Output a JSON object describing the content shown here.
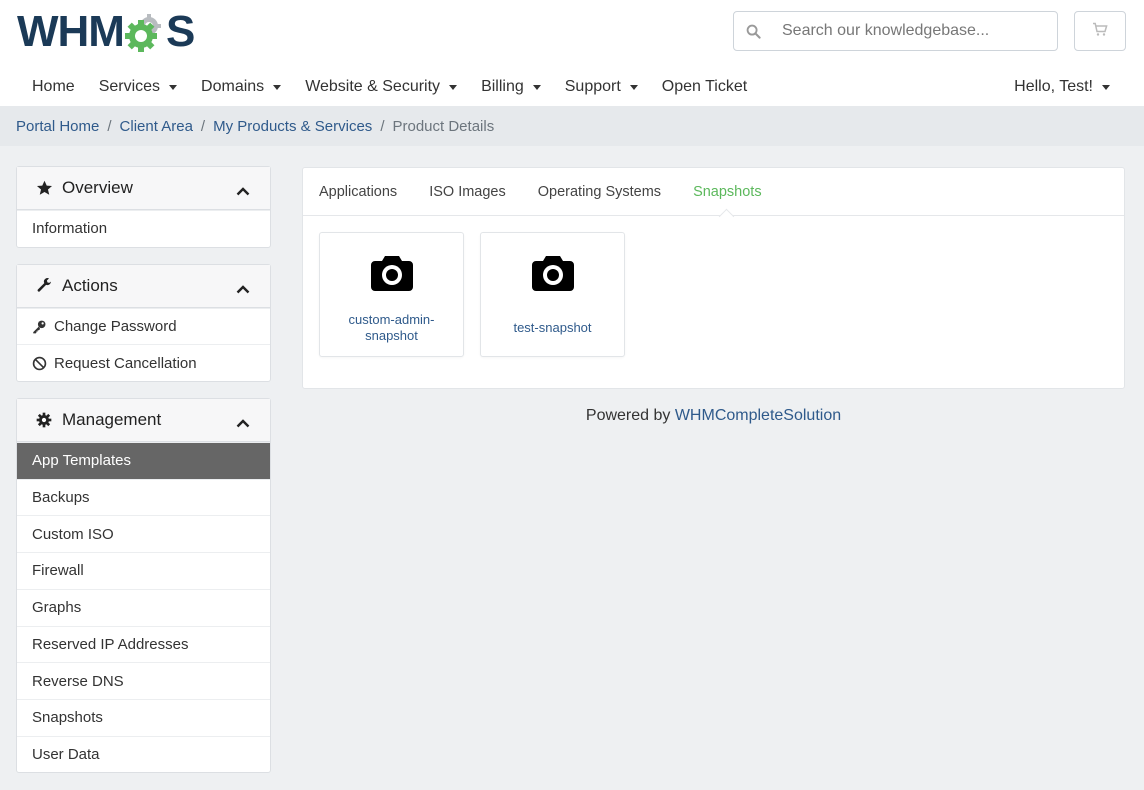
{
  "brand": {
    "logo_left": "WHM",
    "logo_right": "S",
    "accent": "#5cb85c",
    "navy": "#1b3a57"
  },
  "search": {
    "placeholder": "Search our knowledgebase..."
  },
  "nav": {
    "items": [
      {
        "label": "Home",
        "dropdown": false
      },
      {
        "label": "Services",
        "dropdown": true
      },
      {
        "label": "Domains",
        "dropdown": true
      },
      {
        "label": "Website & Security",
        "dropdown": true
      },
      {
        "label": "Billing",
        "dropdown": true
      },
      {
        "label": "Support",
        "dropdown": true
      },
      {
        "label": "Open Ticket",
        "dropdown": false
      }
    ],
    "user_greeting": "Hello, Test!"
  },
  "breadcrumb": {
    "items": [
      "Portal Home",
      "Client Area",
      "My Products & Services"
    ],
    "active": "Product Details"
  },
  "sidebar": {
    "overview": {
      "title": "Overview",
      "items": [
        "Information"
      ]
    },
    "actions": {
      "title": "Actions",
      "items": [
        "Change Password",
        "Request Cancellation"
      ]
    },
    "management": {
      "title": "Management",
      "active": "App Templates",
      "items": [
        "App Templates",
        "Backups",
        "Custom ISO",
        "Firewall",
        "Graphs",
        "Reserved IP Addresses",
        "Reverse DNS",
        "Snapshots",
        "User Data"
      ]
    }
  },
  "tabs": [
    "Applications",
    "ISO Images",
    "Operating Systems",
    "Snapshots"
  ],
  "active_tab": "Snapshots",
  "snapshots": [
    "custom-admin-snapshot",
    "test-snapshot"
  ],
  "footer": {
    "prefix": "Powered by ",
    "link": "WHMCompleteSolution"
  }
}
